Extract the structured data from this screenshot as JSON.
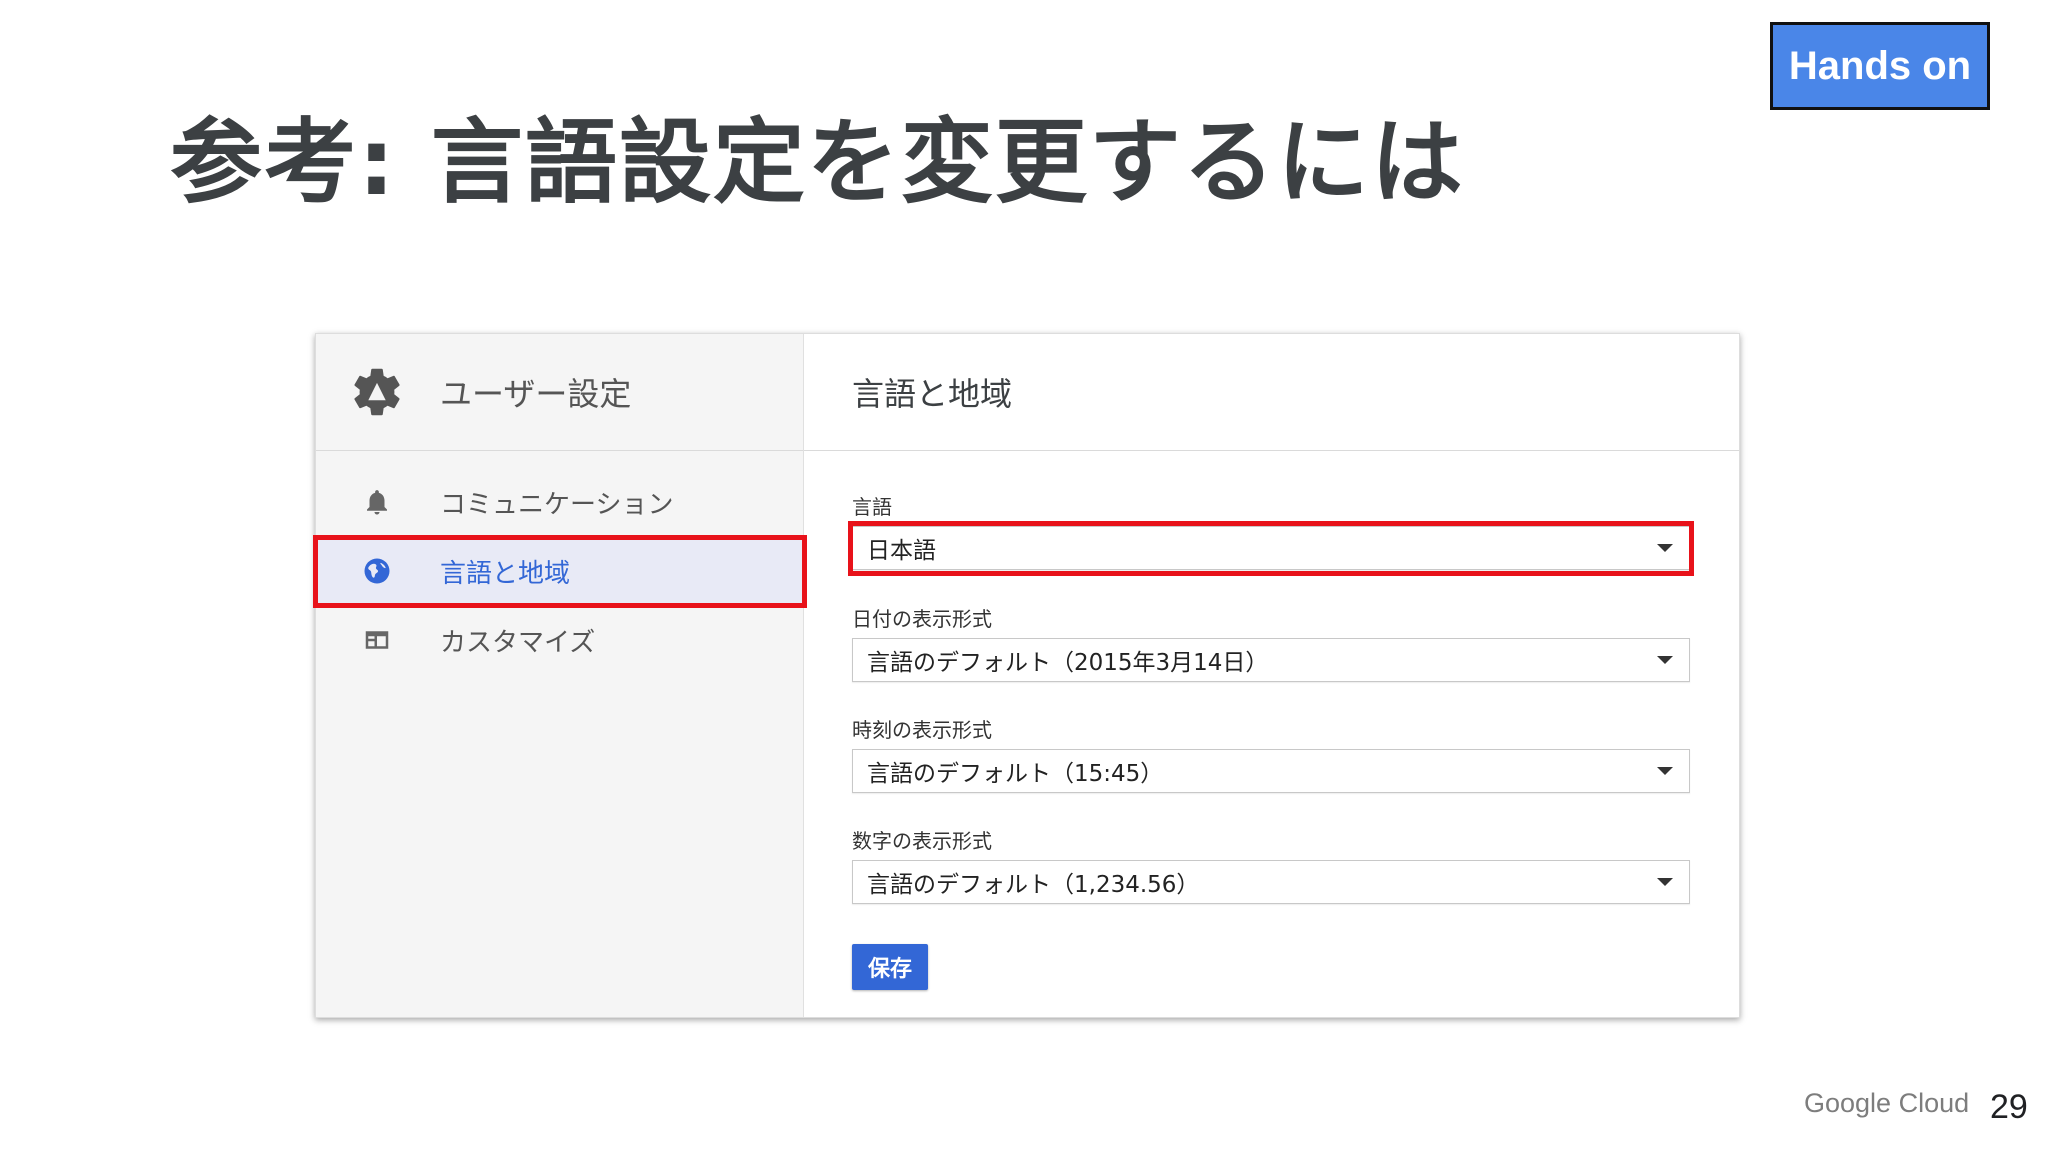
{
  "slide": {
    "title": "参考: 言語設定を変更するには",
    "badge": "Hands on",
    "brand": "Google Cloud",
    "page_number": "29"
  },
  "sidebar": {
    "header_icon": "gear-icon",
    "title": "ユーザー設定",
    "items": [
      {
        "label": "コミュニケーション",
        "icon": "bell-icon",
        "active": false
      },
      {
        "label": "言語と地域",
        "icon": "globe-icon",
        "active": true
      },
      {
        "label": "カスタマイズ",
        "icon": "dashboard-icon",
        "active": false
      }
    ]
  },
  "main": {
    "title": "言語と地域",
    "fields": [
      {
        "label": "言語",
        "value": "日本語"
      },
      {
        "label": "日付の表示形式",
        "value": "言語のデフォルト（2015年3月14日）"
      },
      {
        "label": "時刻の表示形式",
        "value": "言語のデフォルト（15:45）"
      },
      {
        "label": "数字の表示形式",
        "value": "言語のデフォルト（1,234.56）"
      }
    ],
    "save_label": "保存"
  },
  "colors": {
    "accent": "#3367d6",
    "highlight": "#e8121a",
    "badge": "#4a86e8"
  }
}
